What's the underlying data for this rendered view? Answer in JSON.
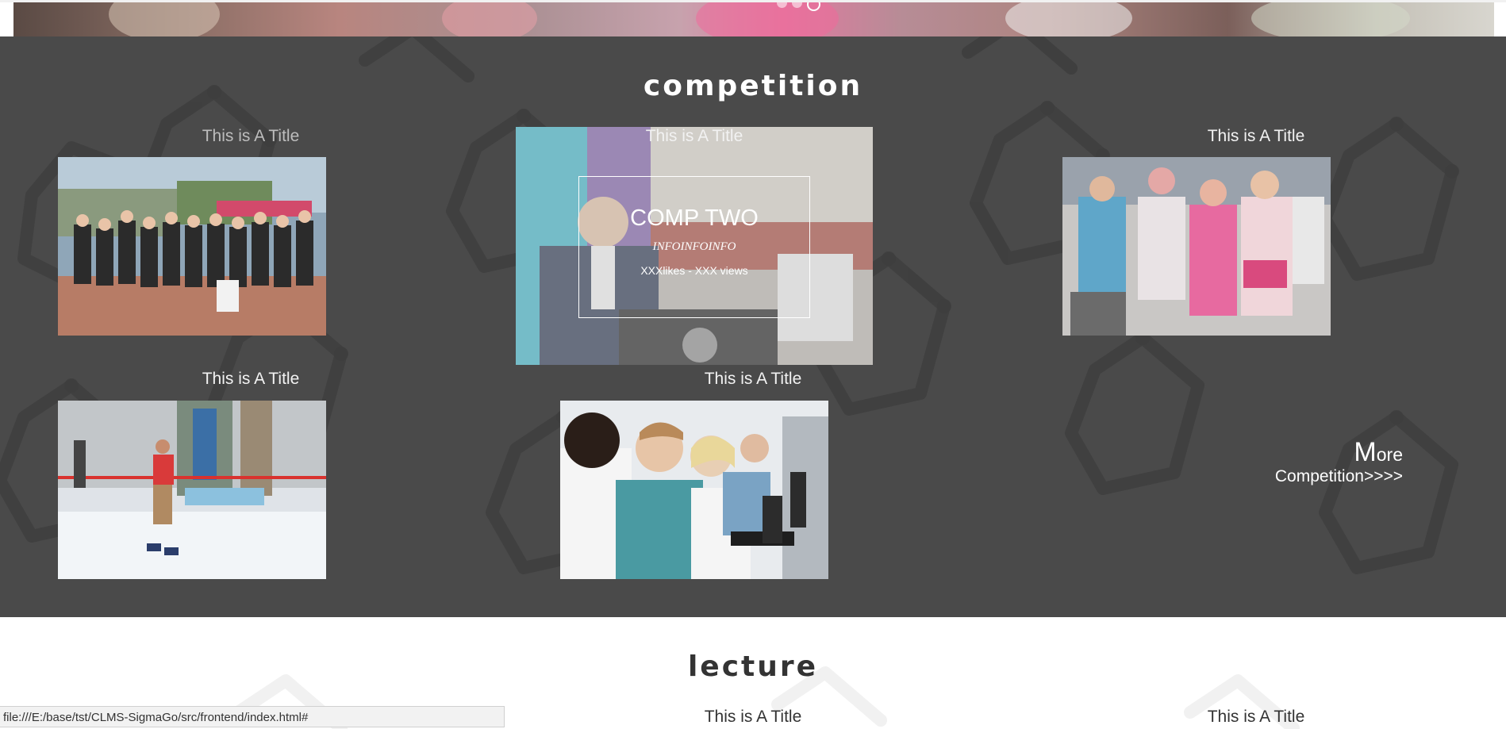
{
  "banner": {
    "carousel": {
      "dot_count": 3,
      "active_index": 2
    }
  },
  "competition": {
    "heading": "competition",
    "cards": [
      {
        "title": "This is A Title",
        "image": "team-photo-track"
      },
      {
        "title": "This is A Title",
        "image": "lecture-speaker"
      },
      {
        "title": "This is A Title",
        "image": "color-run-friends"
      },
      {
        "title": "This is A Title",
        "image": "ice-skater"
      },
      {
        "title": "This is A Title",
        "image": "students-computers"
      }
    ],
    "featured": {
      "heading": "COMP TWO",
      "subtitle": "INFOINFOINFO",
      "stats": "XXXlikes - XXX views"
    },
    "more": {
      "label_initial": "M",
      "label_rest": "ore",
      "link": "Competition>>>>"
    }
  },
  "lecture": {
    "heading": "lecture",
    "cards": [
      {
        "title": "This is A Title"
      },
      {
        "title": "This is A Title"
      }
    ]
  },
  "status_bar": {
    "url": "file:///E:/base/tst/CLMS-SigmaGo/src/frontend/index.html#"
  },
  "colors": {
    "competition_bg": "#4a4a4a",
    "lecture_bg": "#ffffff",
    "heading_light": "#ffffff",
    "heading_dark": "#333333"
  }
}
